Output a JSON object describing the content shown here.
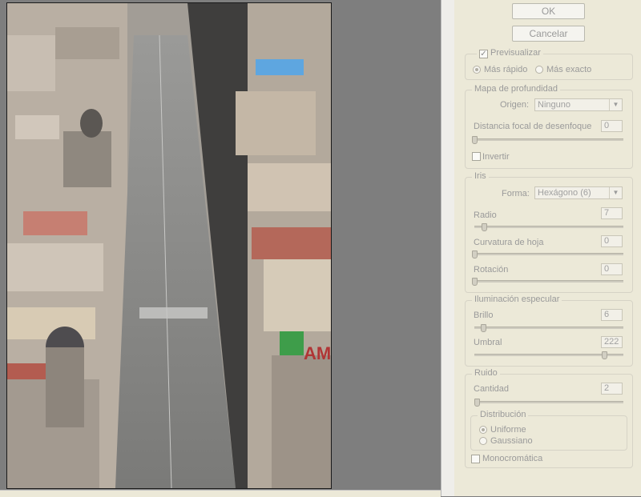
{
  "buttons": {
    "ok": "OK",
    "cancel": "Cancelar"
  },
  "preview": {
    "label": "Previsualizar",
    "checked": true,
    "options": [
      "Más rápido",
      "Más exacto"
    ],
    "selected": "Más rápido"
  },
  "depth_map": {
    "legend": "Mapa de profundidad",
    "source_label": "Origen:",
    "source_value": "Ninguno",
    "focal_label": "Distancia focal de desenfoque",
    "focal_value": "0",
    "invert_label": "Invertir",
    "invert_checked": false
  },
  "iris": {
    "legend": "Iris",
    "shape_label": "Forma:",
    "shape_value": "Hexágono (6)",
    "radius_label": "Radio",
    "radius_value": "7",
    "curvature_label": "Curvatura de hoja",
    "curvature_value": "0",
    "rotation_label": "Rotación",
    "rotation_value": "0"
  },
  "specular": {
    "legend": "Iluminación especular",
    "brightness_label": "Brillo",
    "brightness_value": "6",
    "threshold_label": "Umbral",
    "threshold_value": "222"
  },
  "noise": {
    "legend": "Ruido",
    "amount_label": "Cantidad",
    "amount_value": "2",
    "distribution_legend": "Distribución",
    "distribution_options": [
      "Uniforme",
      "Gaussiano"
    ],
    "distribution_selected": "Uniforme",
    "mono_label": "Monocromática",
    "mono_checked": false
  },
  "preview_image_sign_text": "AM",
  "colors": {
    "panel_bg": "#ece9d8",
    "canvas_bg": "#7e7e7e",
    "disabled_text": "#9a9a9a"
  }
}
